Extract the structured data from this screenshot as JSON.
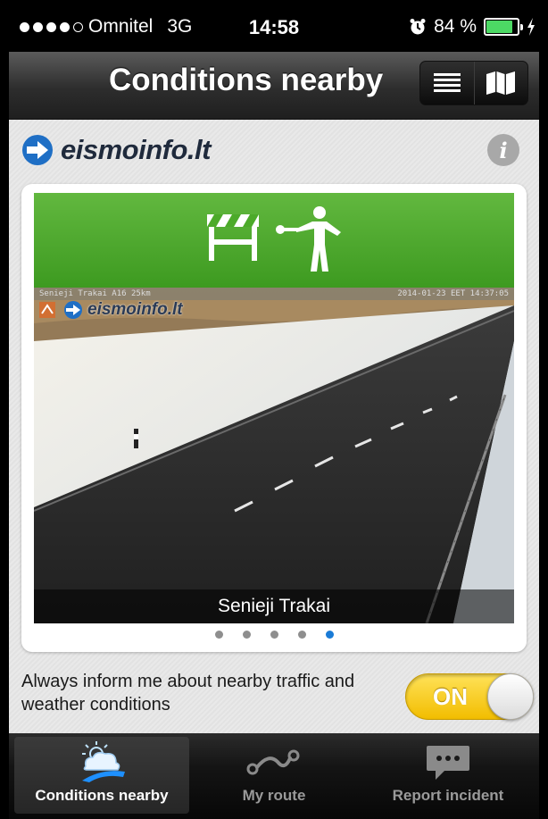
{
  "status_bar": {
    "carrier": "Omnitel",
    "network": "3G",
    "time": "14:58",
    "battery": "84 %",
    "battery_level": 0.84
  },
  "nav": {
    "title": "Conditions nearby",
    "list_icon": "list-icon",
    "map_icon": "map-icon"
  },
  "brand": {
    "name": "eismoinfo.lt",
    "info_icon": "info-icon"
  },
  "camera_card": {
    "banner_icons": [
      "road-barrier-icon",
      "traffic-controller-icon"
    ],
    "banner_color": "#4caa2a",
    "overlay_left": "Senieji Trakai A16 25km",
    "overlay_right": "2014-01-23 EET 14:37:05",
    "watermark": "eismoinfo.lt",
    "location": "Senieji Trakai",
    "page_count": 5,
    "active_page": 5
  },
  "setting": {
    "label": "Always inform me about nearby traffic and weather conditions",
    "toggle_text": "ON",
    "toggle_on": true,
    "toggle_color": "#f7c600"
  },
  "tabs": [
    {
      "label": "Conditions nearby",
      "icon": "weather-road-icon",
      "active": true
    },
    {
      "label": "My route",
      "icon": "route-icon",
      "active": false
    },
    {
      "label": "Report incident",
      "icon": "chat-bubble-icon",
      "active": false
    }
  ]
}
